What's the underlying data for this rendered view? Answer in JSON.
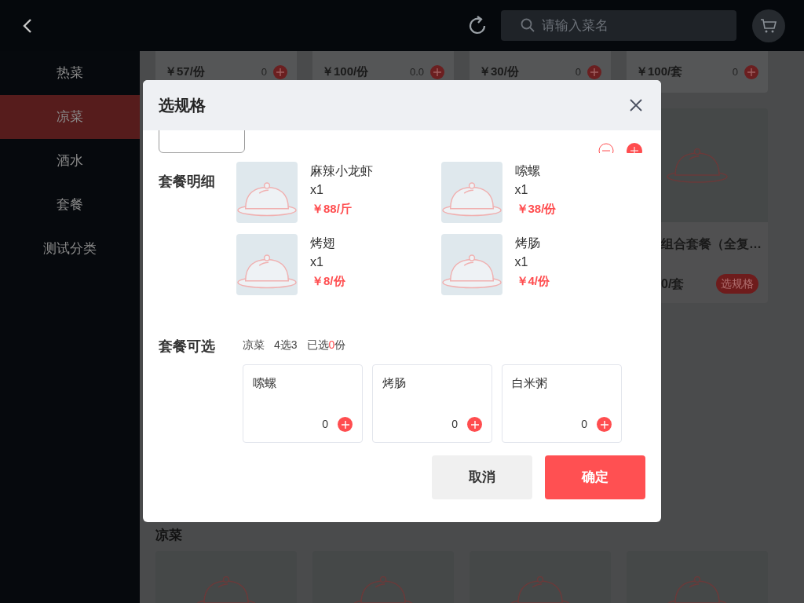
{
  "topbar": {
    "search": {
      "placeholder": "请输入菜名"
    }
  },
  "sidebar": {
    "items": [
      {
        "label": "热菜",
        "selected": false
      },
      {
        "label": "凉菜",
        "selected": true
      },
      {
        "label": "酒水",
        "selected": false
      },
      {
        "label": "套餐",
        "selected": false
      },
      {
        "label": "测试分类",
        "selected": false
      }
    ]
  },
  "menu": {
    "top_cards": [
      {
        "price": "￥57/份",
        "count": "0"
      },
      {
        "price": "￥100/份",
        "count": "0.0"
      },
      {
        "price": "￥30/份",
        "count": "0"
      },
      {
        "price": "￥100/套",
        "count": "0"
      }
    ],
    "partial_card": {
      "name": "组合套餐（全复…",
      "price": "0/套",
      "action": "选规格"
    },
    "section_title": "凉菜"
  },
  "dialog": {
    "title": "选规格",
    "details_label": "套餐明细",
    "details": [
      {
        "name": "麻辣小龙虾",
        "qty": "x1",
        "price": "￥88/斤"
      },
      {
        "name": "嗦螺",
        "qty": "x1",
        "price": "￥38/份"
      },
      {
        "name": "烤翅",
        "qty": "x1",
        "price": "￥8/份"
      },
      {
        "name": "烤肠",
        "qty": "x1",
        "price": "￥4/份"
      }
    ],
    "options_label": "套餐可选",
    "options_info": {
      "category": "凉菜",
      "rule": "4选3",
      "selected_label": "已选",
      "selected_count": "0",
      "selected_unit": "份"
    },
    "options": [
      {
        "name": "嗦螺",
        "count": "0"
      },
      {
        "name": "烤肠",
        "count": "0"
      },
      {
        "name": "白米粥",
        "count": "0"
      }
    ],
    "buttons": [
      {
        "label": "取消",
        "kind": "secondary"
      },
      {
        "label": "确定",
        "kind": "primary"
      }
    ]
  }
}
